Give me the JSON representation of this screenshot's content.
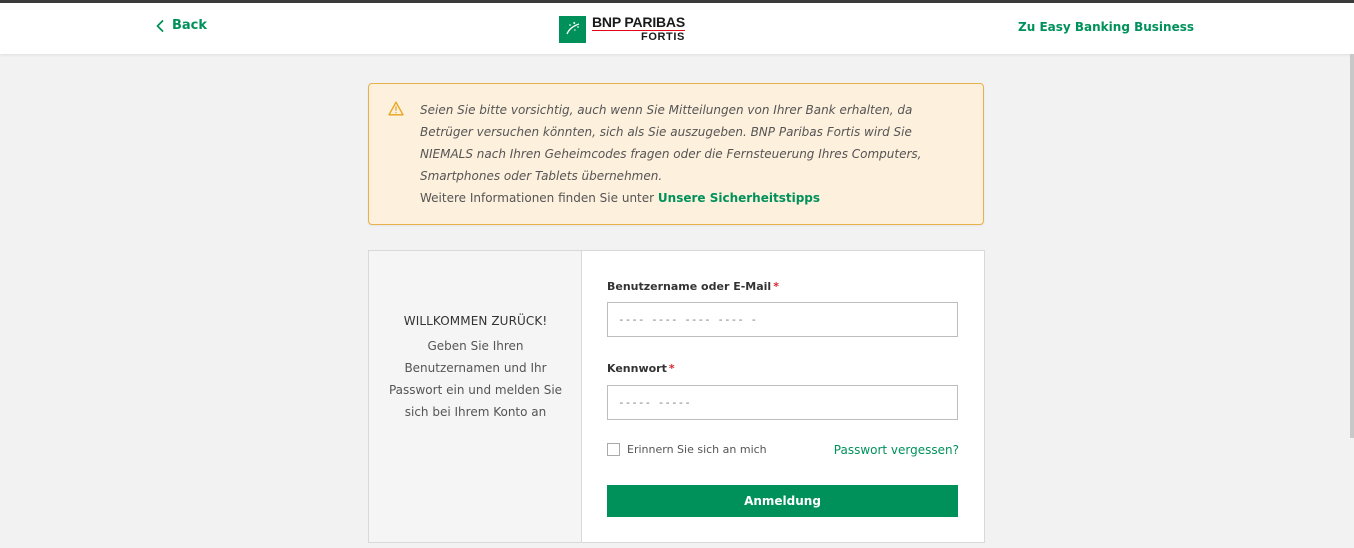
{
  "header": {
    "back_label": "Back",
    "logo_line1": "BNP PARIBAS",
    "logo_line2": "FORTIS",
    "right_link": "Zu Easy Banking Business"
  },
  "warning": {
    "message": "Seien Sie bitte vorsichtig, auch wenn Sie Mitteilungen von Ihrer Bank erhalten, da Betrüger versuchen könnten, sich als Sie auszugeben. BNP Paribas Fortis wird Sie NIEMALS nach Ihren Geheimcodes fragen oder die Fernsteuerung Ihres Computers, Smartphones oder Tablets übernehmen.",
    "more_prefix": "Weitere Informationen finden Sie unter",
    "more_link": "Unsere Sicherheitstipps"
  },
  "welcome": {
    "title": "WILLKOMMEN ZURÜCK!",
    "description": "Geben Sie Ihren Benutzernamen und Ihr Passwort ein und melden Sie sich bei Ihrem Konto an"
  },
  "form": {
    "username_label": "Benutzername oder E-Mail",
    "username_placeholder": "---- ---- ---- ---- -",
    "password_label": "Kennwort",
    "password_placeholder": "----- -----",
    "required_marker": "*",
    "remember_label": "Erinnern Sie sich an mich",
    "forgot_label": "Passwort vergessen?",
    "submit_label": "Anmeldung"
  },
  "colors": {
    "brand_green": "#00915a",
    "warning_bg": "#fdf0dd",
    "warning_border": "#e8b14c",
    "required_red": "#d8262e"
  },
  "icons": {
    "back": "chevron-left-icon",
    "warning": "warning-triangle-icon",
    "logo": "bnp-stars-logo-icon"
  }
}
